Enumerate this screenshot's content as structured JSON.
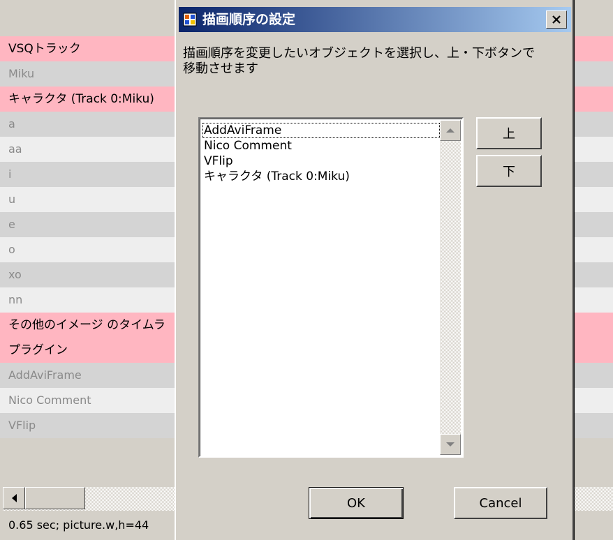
{
  "background_app": {
    "track_rows": [
      {
        "label": "VSQトラック",
        "kind": "header"
      },
      {
        "label": "Miku",
        "kind": "even"
      },
      {
        "label": "キャラクタ (Track 0:Miku)",
        "kind": "header"
      },
      {
        "label": "a",
        "kind": "even"
      },
      {
        "label": "aa",
        "kind": "odd"
      },
      {
        "label": "i",
        "kind": "even"
      },
      {
        "label": "u",
        "kind": "odd"
      },
      {
        "label": "e",
        "kind": "even"
      },
      {
        "label": "o",
        "kind": "odd"
      },
      {
        "label": "xo",
        "kind": "even"
      },
      {
        "label": "nn",
        "kind": "odd"
      },
      {
        "label": "その他のイメージ のタイムラ",
        "kind": "header"
      },
      {
        "label": "プラグイン",
        "kind": "header"
      },
      {
        "label": "AddAviFrame",
        "kind": "even"
      },
      {
        "label": "Nico Comment",
        "kind": "odd"
      },
      {
        "label": "VFlip",
        "kind": "even"
      }
    ],
    "status_text": "0.65 sec; picture.w,h=44"
  },
  "dialog": {
    "title": "描画順序の設定",
    "instruction": "描画順序を変更したいオブジェクトを選択し、上・下ボタンで移動させます",
    "list_items": [
      "AddAviFrame",
      "Nico Comment",
      "VFlip",
      "キャラクタ (Track 0:Miku)"
    ],
    "selected_index": 0,
    "up_label": "上",
    "down_label": "下",
    "ok_label": "OK",
    "cancel_label": "Cancel"
  },
  "colors": {
    "header_row": "#ffb6c1",
    "titlebar_start": "#0a246a",
    "titlebar_end": "#a6caf0",
    "face": "#d4d0c8"
  },
  "icons": {
    "title_icon": "app-window-icon",
    "close": "close-icon"
  }
}
